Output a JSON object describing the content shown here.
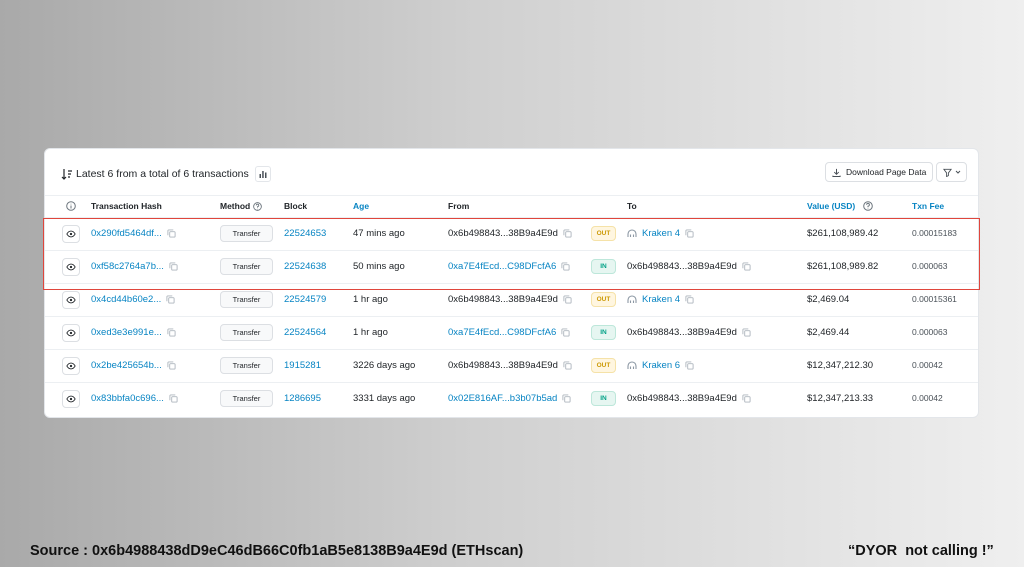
{
  "summary": {
    "text": "Latest 6 from a total of 6 transactions"
  },
  "toolbar": {
    "download_label": "Download Page Data"
  },
  "columns": {
    "hash": "Transaction Hash",
    "method": "Method",
    "block": "Block",
    "age": "Age",
    "from": "From",
    "to": "To",
    "value": "Value (USD)",
    "fee": "Txn Fee"
  },
  "rows": [
    {
      "hash": "0x290fd5464df...",
      "method": "Transfer",
      "block": "22524653",
      "age": "47 mins ago",
      "from": "0x6b498843...38B9a4E9d",
      "from_link": false,
      "direction": "OUT",
      "to": "Kraken 4",
      "to_link": true,
      "value": "$261,108,989.42",
      "fee": "0.00015183"
    },
    {
      "hash": "0xf58c2764a7b...",
      "method": "Transfer",
      "block": "22524638",
      "age": "50 mins ago",
      "from": "0xa7E4fEcd...C98DFcfA6",
      "from_link": true,
      "direction": "IN",
      "to": "0x6b498843...38B9a4E9d",
      "to_link": false,
      "value": "$261,108,989.82",
      "fee": "0.000063"
    },
    {
      "hash": "0x4cd44b60e2...",
      "method": "Transfer",
      "block": "22524579",
      "age": "1 hr ago",
      "from": "0x6b498843...38B9a4E9d",
      "from_link": false,
      "direction": "OUT",
      "to": "Kraken 4",
      "to_link": true,
      "value": "$2,469.04",
      "fee": "0.00015361"
    },
    {
      "hash": "0xed3e3e991e...",
      "method": "Transfer",
      "block": "22524564",
      "age": "1 hr ago",
      "from": "0xa7E4fEcd...C98DFcfA6",
      "from_link": true,
      "direction": "IN",
      "to": "0x6b498843...38B9a4E9d",
      "to_link": false,
      "value": "$2,469.44",
      "fee": "0.000063"
    },
    {
      "hash": "0x2be425654b...",
      "method": "Transfer",
      "block": "1915281",
      "age": "3226 days ago",
      "from": "0x6b498843...38B9a4E9d",
      "from_link": false,
      "direction": "OUT",
      "to": "Kraken 6",
      "to_link": true,
      "value": "$12,347,212.30",
      "fee": "0.00042"
    },
    {
      "hash": "0x83bbfa0c696...",
      "method": "Transfer",
      "block": "1286695",
      "age": "3331 days ago",
      "from": "0x02E816AF...b3b07b5ad",
      "from_link": true,
      "direction": "IN",
      "to": "0x6b498843...38B9a4E9d",
      "to_link": false,
      "value": "$12,347,213.33",
      "fee": "0.00042"
    }
  ],
  "footer": {
    "source": "Source : 0x6b4988438dD9eC46dB66C0fb1aB5e8138B9a4E9d (ETHscan)",
    "note": "“DYOR  not calling !”"
  },
  "colors": {
    "link": "#0784c3",
    "highlight": "#e0463c",
    "out": "#cc9a06",
    "in": "#00a186"
  }
}
